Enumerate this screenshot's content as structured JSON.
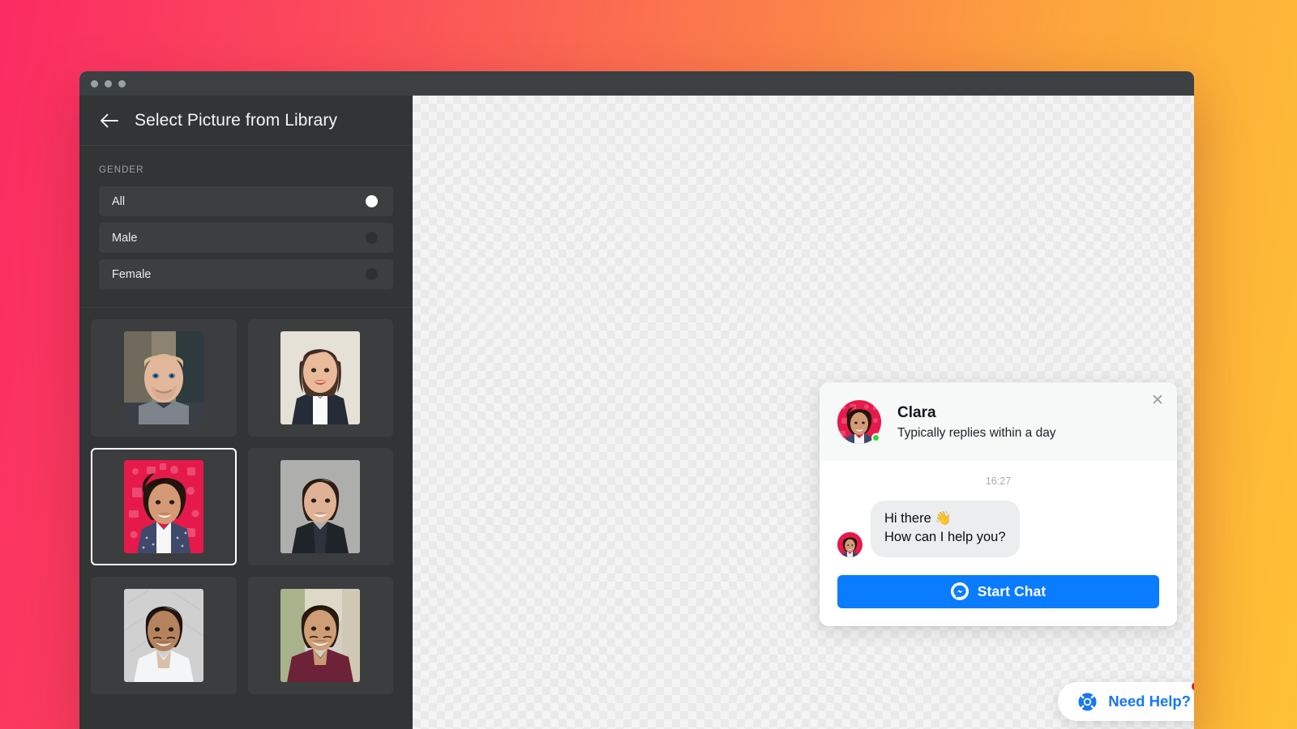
{
  "backdrop": {
    "gradient_start": "#FB2B63",
    "gradient_end": "#FDC135"
  },
  "window": {
    "traffic_lights": [
      "close-dot",
      "minimize-dot",
      "maximize-dot"
    ],
    "dot_color": "#9AA0A4",
    "chrome_color": "#3C4043"
  },
  "sidebar": {
    "back_icon": "arrow-left-icon",
    "title": "Select Picture from Library",
    "background": "#323436",
    "filter": {
      "label": "GENDER",
      "options": [
        {
          "label": "All",
          "selected": true
        },
        {
          "label": "Male",
          "selected": false
        },
        {
          "label": "Female",
          "selected": false
        }
      ]
    },
    "thumbnails": [
      {
        "alt": "portrait-man-blond-blue-shirt",
        "selected": false
      },
      {
        "alt": "portrait-woman-dark-blazer",
        "selected": false
      },
      {
        "alt": "portrait-woman-red-background",
        "selected": true
      },
      {
        "alt": "portrait-man-grey-background",
        "selected": false
      },
      {
        "alt": "portrait-man-white-tshirt",
        "selected": false
      },
      {
        "alt": "portrait-man-maroon-shirt",
        "selected": false
      }
    ]
  },
  "canvas": {
    "pattern": "transparency-checkerboard",
    "light": "#F4F4F4",
    "dark": "#EAEAEA"
  },
  "chat_widget": {
    "close_icon": "close-icon",
    "agent_name": "Clara",
    "agent_status": "Typically replies within a day",
    "online_indicator_color": "#31D63A",
    "timestamp": "16:27",
    "message": "Hi there 👋\nHow can I help you?",
    "message_line_1": "Hi there 👋",
    "message_line_2": "How can I help you?",
    "start_chat_label": "Start Chat",
    "start_chat_icon": "messenger-icon",
    "start_chat_color": "#0A7CFF"
  },
  "need_help": {
    "label": "Need Help?",
    "icon": "lifebuoy-icon",
    "text_color": "#1877F2",
    "badge_color": "#E02020"
  }
}
